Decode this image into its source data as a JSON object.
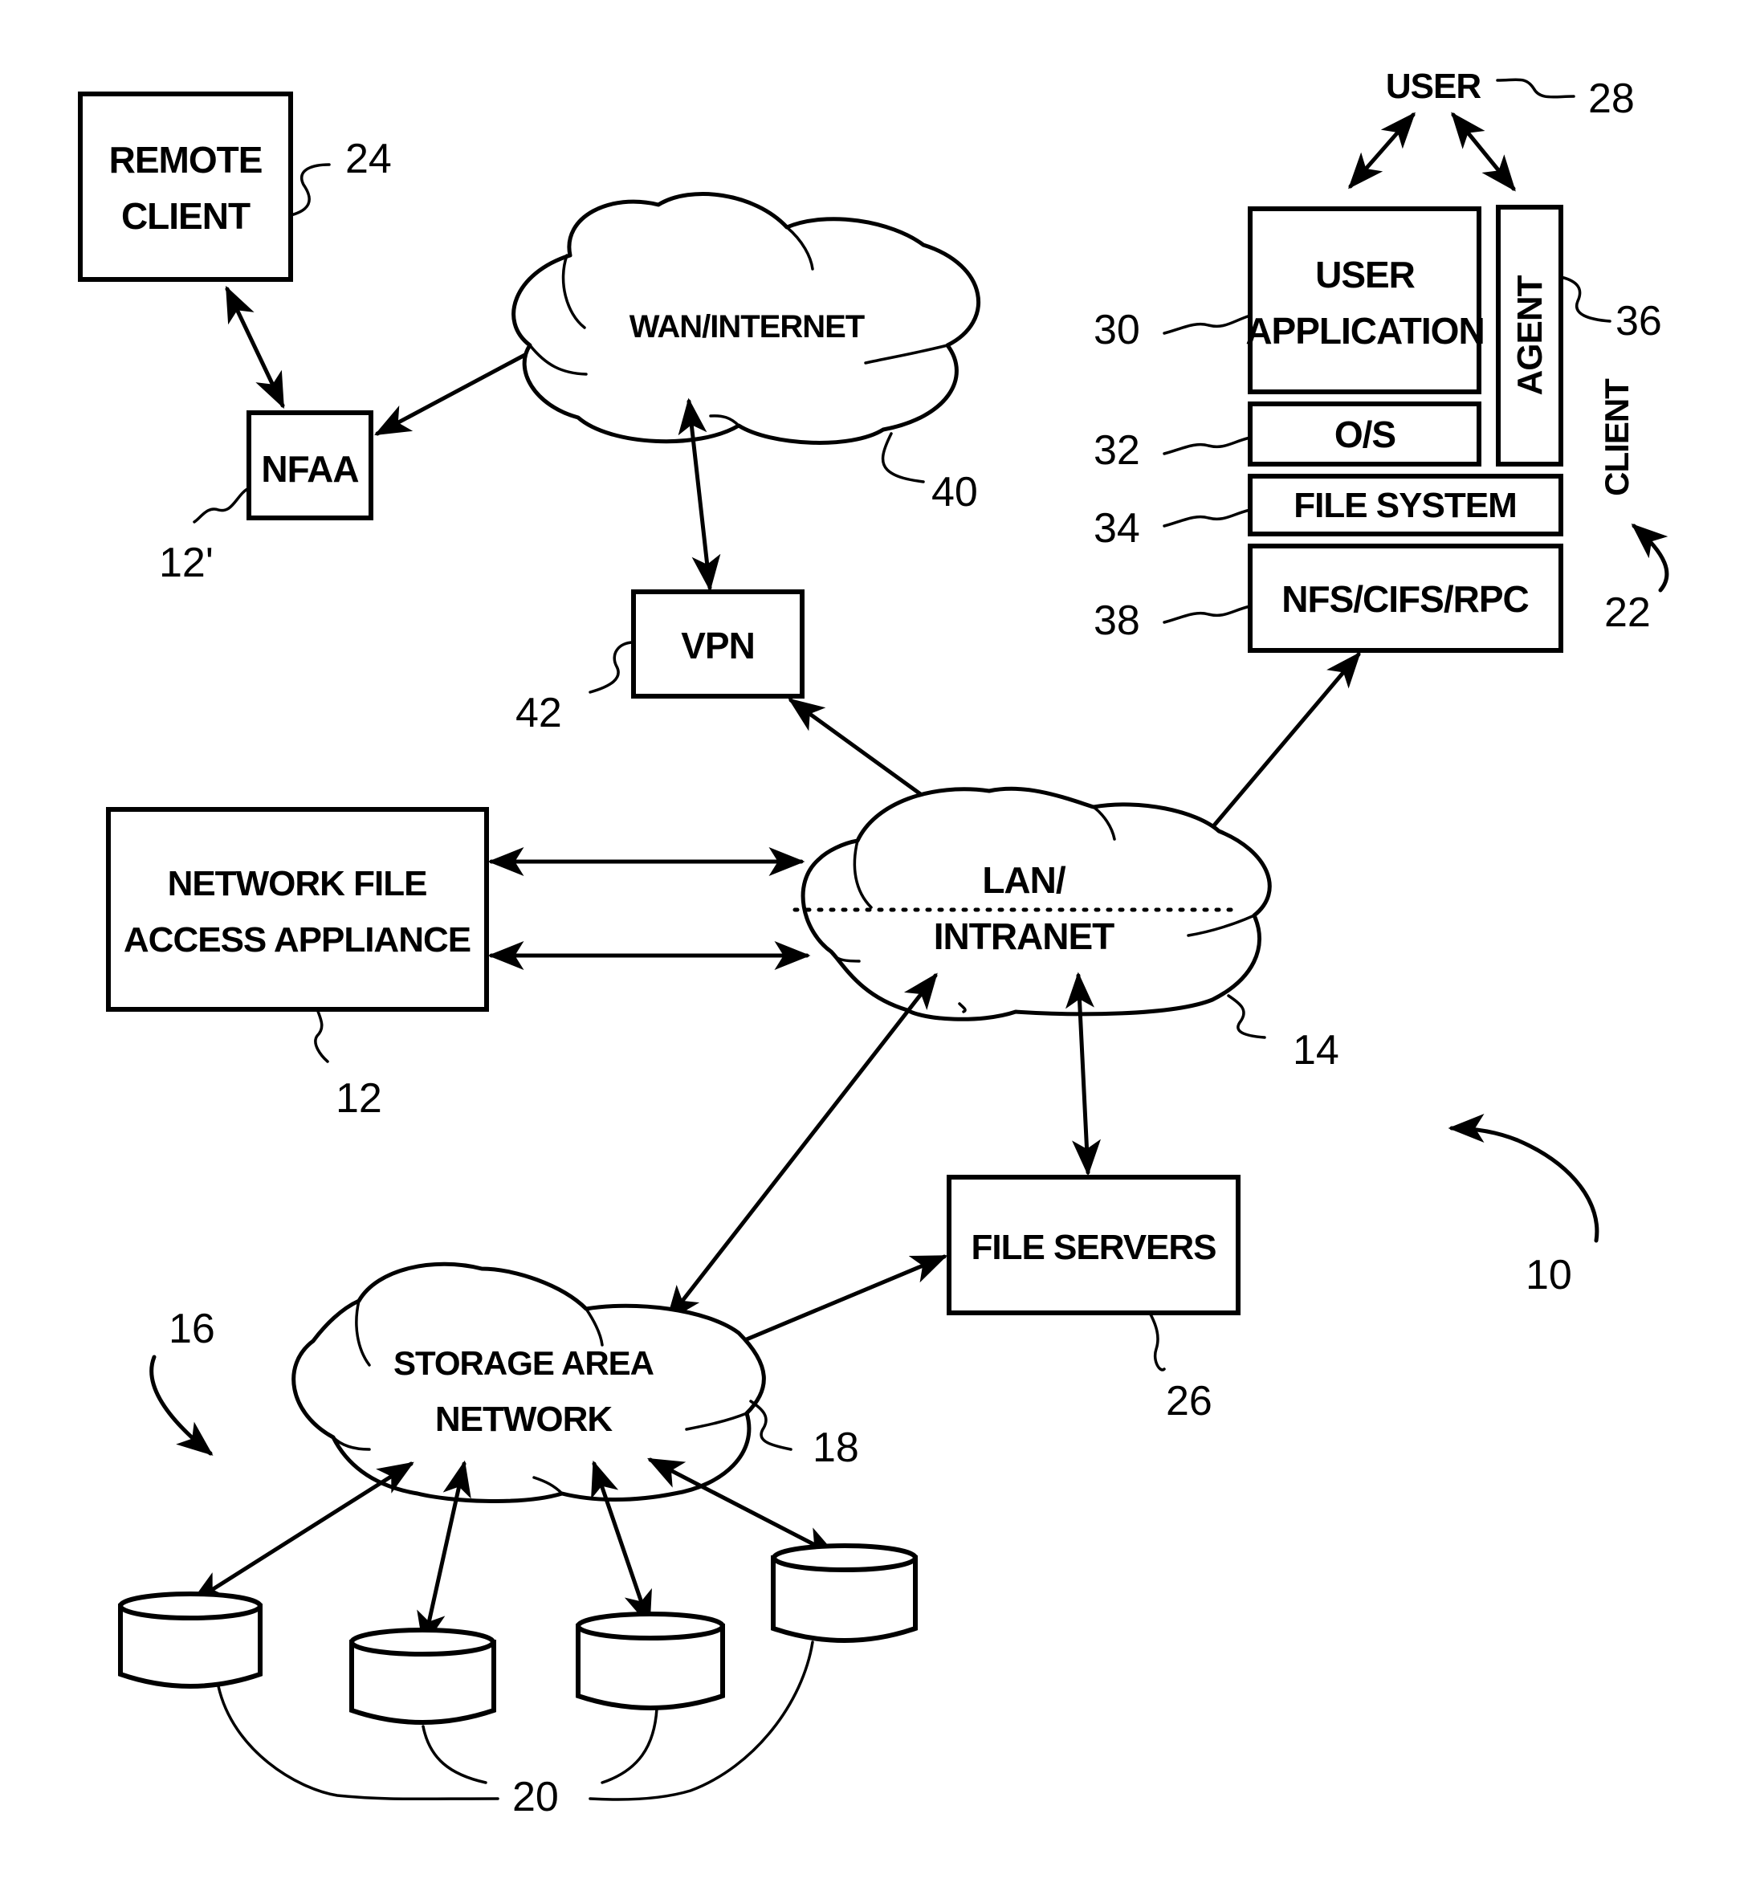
{
  "figure": {
    "system_ref": "10",
    "colors": {
      "ink": "#000000",
      "paper": "#ffffff"
    },
    "nodes": {
      "remote_client": {
        "line1": "REMOTE",
        "line2": "CLIENT",
        "ref": "24"
      },
      "nfaa_remote": {
        "label": "NFAA",
        "ref": "12'"
      },
      "wan": {
        "label": "WAN/INTERNET",
        "ref": "40"
      },
      "vpn": {
        "label": "VPN",
        "ref": "42"
      },
      "user": {
        "label": "USER",
        "ref": "28"
      },
      "user_application": {
        "line1": "USER",
        "line2": "APPLICATION",
        "ref": "30"
      },
      "agent": {
        "label": "AGENT",
        "ref": "36"
      },
      "os": {
        "label": "O/S",
        "ref": "32"
      },
      "file_system": {
        "label": "FILE SYSTEM",
        "ref": "34"
      },
      "protocols": {
        "label": "NFS/CIFS/RPC",
        "ref": "38"
      },
      "client": {
        "label": "CLIENT",
        "ref": "22"
      },
      "nfaa": {
        "line1": "NETWORK FILE",
        "line2": "ACCESS APPLIANCE",
        "ref": "12"
      },
      "lan": {
        "line1": "LAN/",
        "line2": "INTRANET",
        "ref": "14"
      },
      "file_servers": {
        "label": "FILE SERVERS",
        "ref": "26"
      },
      "san": {
        "line1": "STORAGE AREA",
        "line2": "NETWORK",
        "ref": "18",
        "group_ref": "16"
      },
      "storage": {
        "ref": "20",
        "count": 4
      }
    },
    "connections": [
      {
        "from": "remote_client",
        "to": "nfaa_remote",
        "type": "bidirectional"
      },
      {
        "from": "nfaa_remote",
        "to": "wan",
        "type": "bidirectional"
      },
      {
        "from": "wan",
        "to": "vpn",
        "type": "bidirectional"
      },
      {
        "from": "vpn",
        "to": "lan",
        "type": "bidirectional"
      },
      {
        "from": "user",
        "to": "user_application",
        "type": "bidirectional"
      },
      {
        "from": "user",
        "to": "agent",
        "type": "bidirectional"
      },
      {
        "from": "protocols",
        "to": "lan",
        "type": "bidirectional"
      },
      {
        "from": "nfaa",
        "to": "lan",
        "type": "bidirectional"
      },
      {
        "from": "nfaa",
        "to": "lan",
        "type": "bidirectional"
      },
      {
        "from": "lan",
        "to": "san",
        "type": "bidirectional"
      },
      {
        "from": "lan",
        "to": "file_servers",
        "type": "bidirectional"
      },
      {
        "from": "file_servers",
        "to": "san",
        "type": "bidirectional"
      },
      {
        "from": "san",
        "to": "storage-1",
        "type": "bidirectional"
      },
      {
        "from": "san",
        "to": "storage-2",
        "type": "bidirectional"
      },
      {
        "from": "san",
        "to": "storage-3",
        "type": "bidirectional"
      },
      {
        "from": "san",
        "to": "storage-4",
        "type": "bidirectional"
      }
    ]
  }
}
